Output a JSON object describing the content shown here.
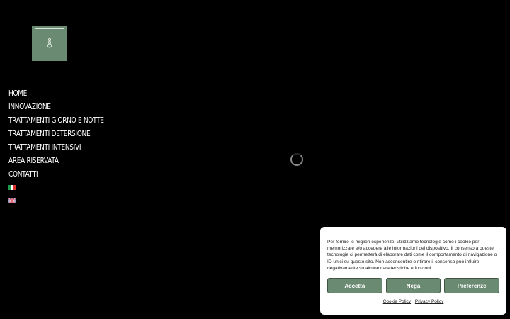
{
  "logo": {
    "icon": "keyhole-logo-icon",
    "color": "#6b8a72"
  },
  "nav": {
    "items": [
      "HOME",
      "INNOVAZIONE",
      "TRATTAMENTI GIORNO E NOTTE",
      "TRATTAMENTI DETERSIONE",
      "TRATTAMENTI INTENSIVI",
      "AREA RISERVATA",
      "CONTATTI"
    ],
    "languages": [
      "it-flag-icon",
      "uk-flag-icon"
    ]
  },
  "loader": {
    "icon": "loading-spinner-icon"
  },
  "cookie_banner": {
    "text": "Per fornire le migliori esperienze, utilizziamo tecnologie come i cookie per memorizzare e/o accedere alle informazioni del dispositivo. Il consenso a queste tecnologie ci permetterà di elaborare dati come il comportamento di navigazione o ID unici su questo sito. Non acconsentire o ritirare il consenso può influire negativamente su alcune caratteristiche e funzioni.",
    "accept_label": "Accetta",
    "deny_label": "Nega",
    "preferences_label": "Preferenze",
    "cookie_policy_label": "Cookie Policy",
    "privacy_policy_label": "Privacy Policy",
    "button_color": "#6b8a72"
  }
}
